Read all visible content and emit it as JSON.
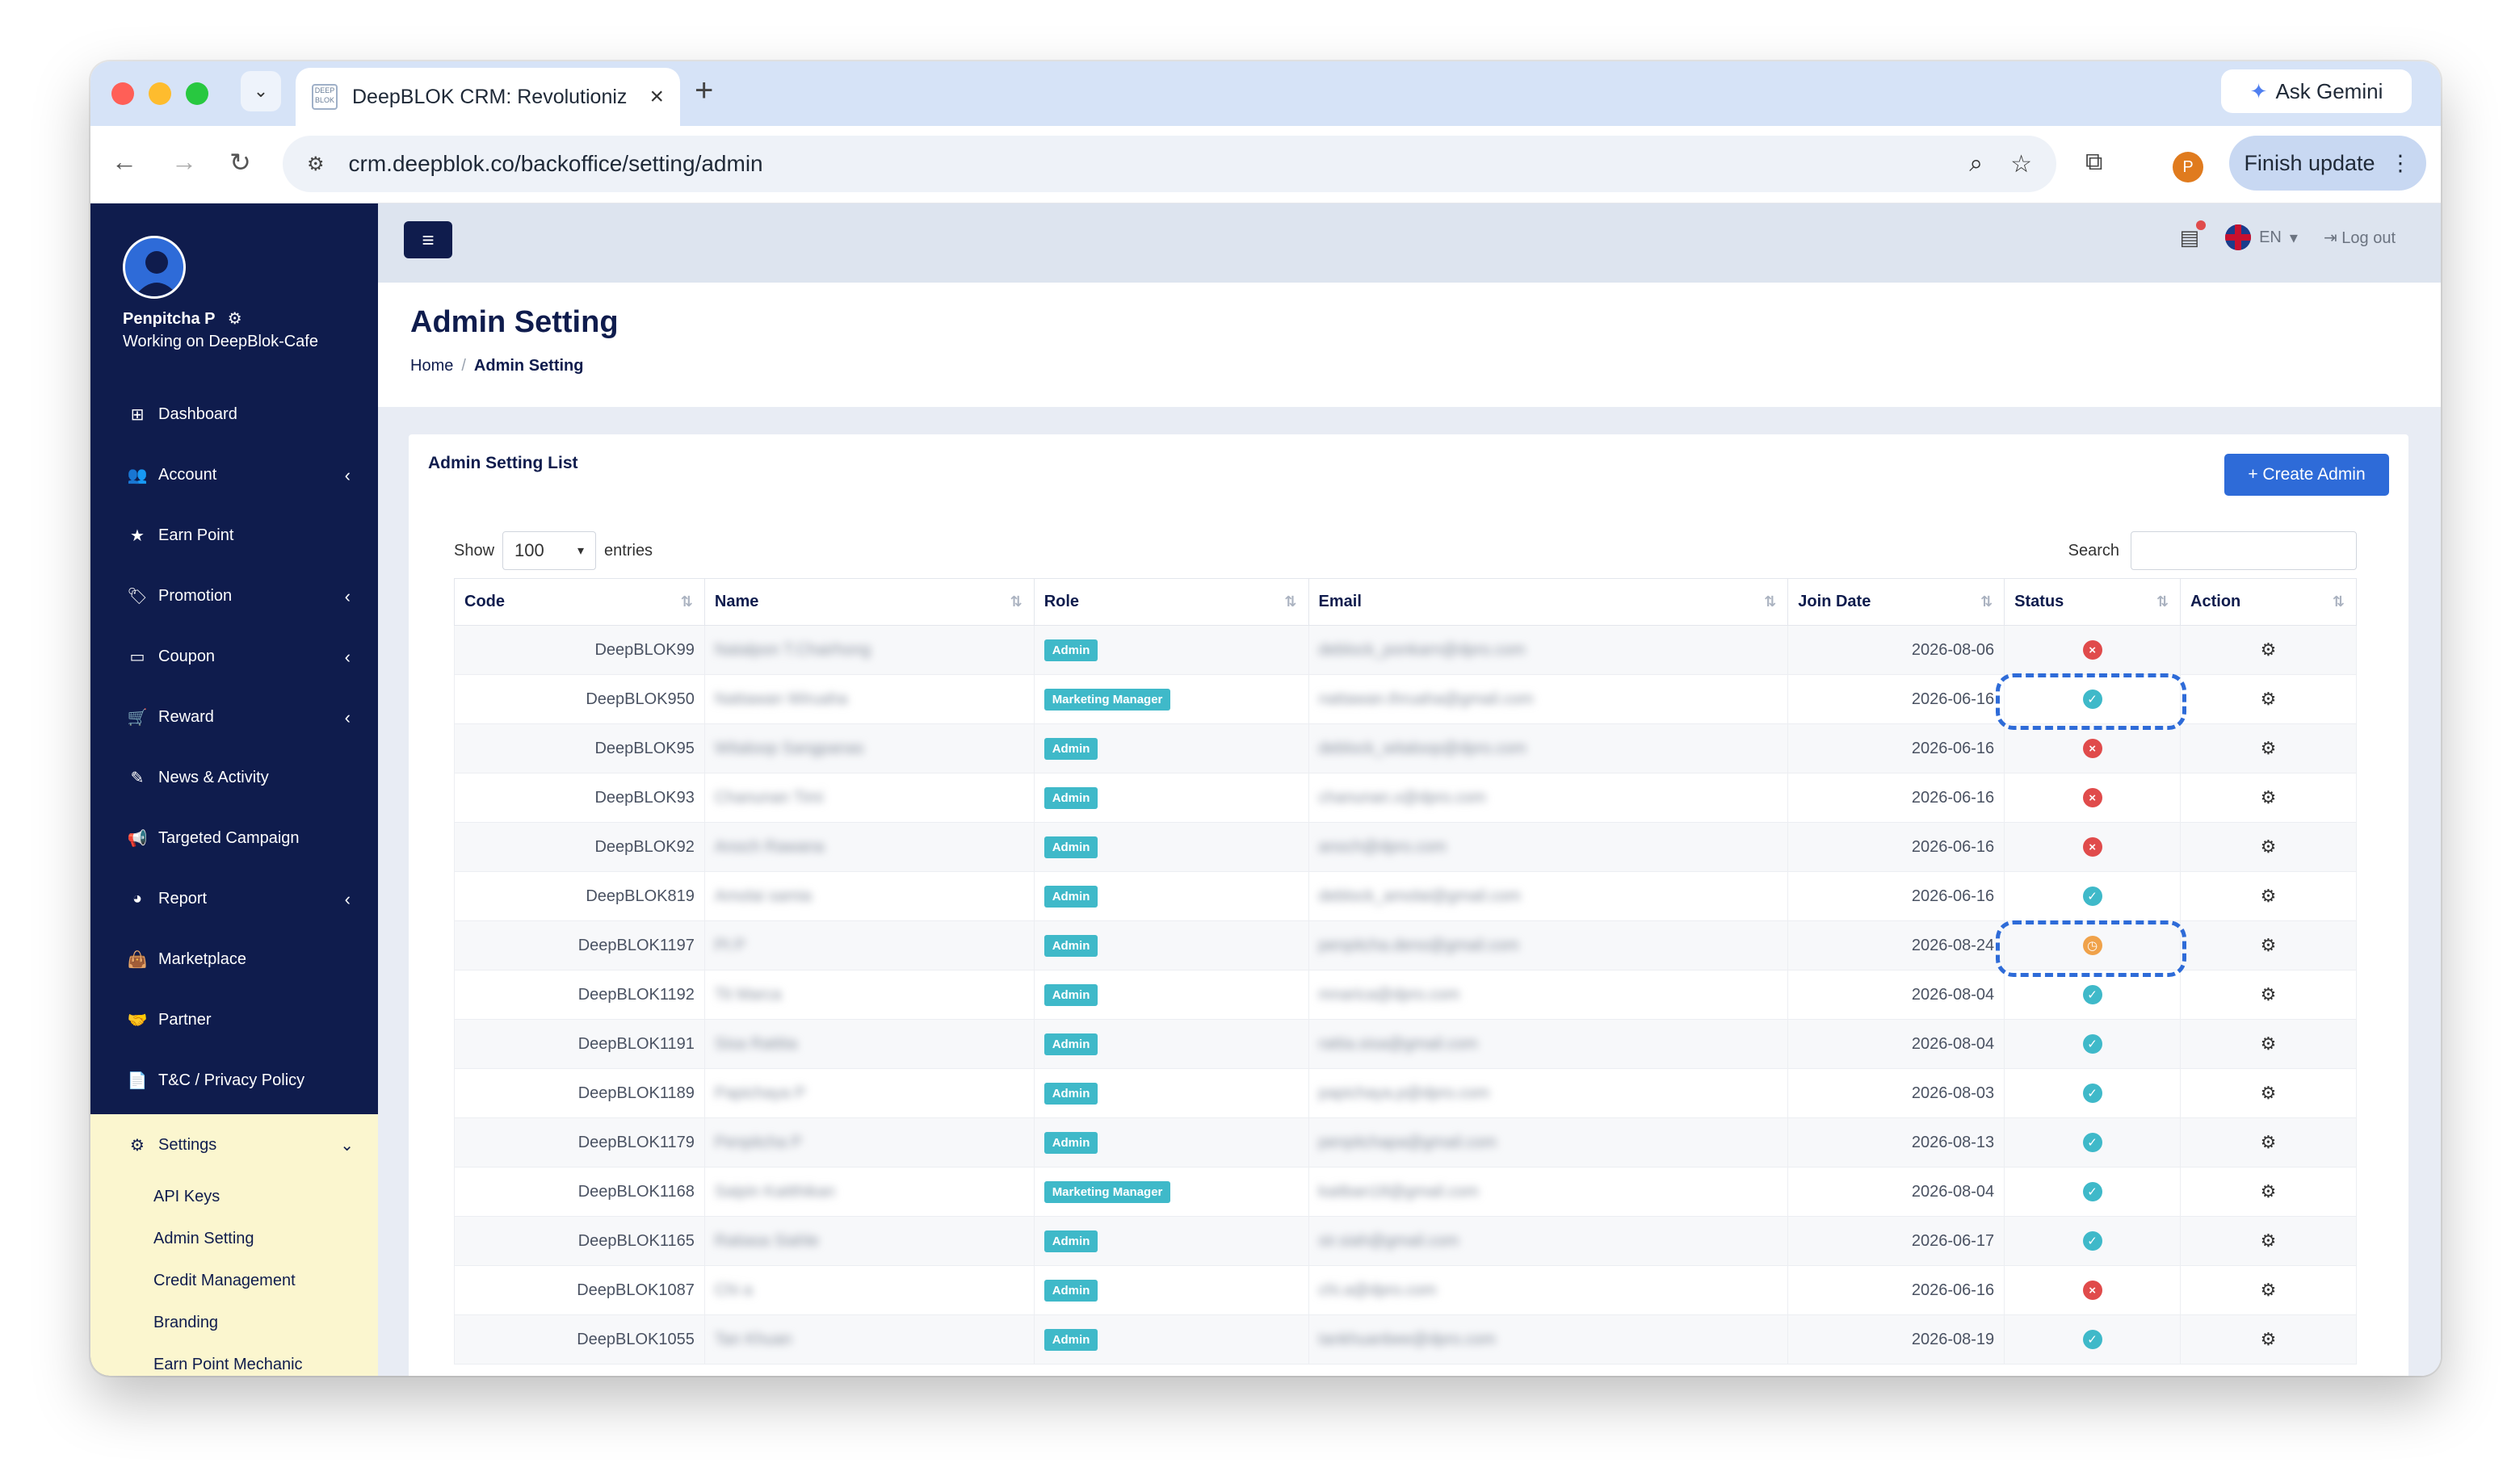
{
  "browser": {
    "tab_title": "DeepBLOK CRM: Revolutioniz",
    "favicon_text": "DEEP BLOK",
    "url": "crm.deepblok.co/backoffice/setting/admin",
    "ask_gemini": "Ask Gemini",
    "finish_update": "Finish update",
    "profile_initial": "P",
    "colors": {
      "tabbar": "#d6e3f7",
      "close": "#ff5f57",
      "minimize": "#febc2e",
      "zoom": "#28c840"
    }
  },
  "sidebar": {
    "user_name": "Penpitcha P",
    "working_on": "Working on DeepBlok-Cafe",
    "items": [
      {
        "label": "Dashboard",
        "icon": "dashboard-icon",
        "glyph": "⊞",
        "chevron": false
      },
      {
        "label": "Account",
        "icon": "users-icon",
        "glyph": "👥",
        "chevron": true
      },
      {
        "label": "Earn Point",
        "icon": "star-icon",
        "glyph": "★",
        "chevron": false
      },
      {
        "label": "Promotion",
        "icon": "tag-icon",
        "glyph": "🏷",
        "chevron": true
      },
      {
        "label": "Coupon",
        "icon": "ticket-icon",
        "glyph": "▭",
        "chevron": true
      },
      {
        "label": "Reward",
        "icon": "cart-icon",
        "glyph": "🛒",
        "chevron": true
      },
      {
        "label": "News & Activity",
        "icon": "edit-icon",
        "glyph": "✎",
        "chevron": false
      },
      {
        "label": "Targeted Campaign",
        "icon": "megaphone-icon",
        "glyph": "📢",
        "chevron": false
      },
      {
        "label": "Report",
        "icon": "chart-pie-icon",
        "glyph": "◕",
        "chevron": true
      },
      {
        "label": "Marketplace",
        "icon": "bag-icon",
        "glyph": "👜",
        "chevron": false
      },
      {
        "label": "Partner",
        "icon": "handshake-icon",
        "glyph": "🤝",
        "chevron": false
      },
      {
        "label": "T&C / Privacy Policy",
        "icon": "document-icon",
        "glyph": "📄",
        "chevron": false
      }
    ],
    "settings": {
      "label": "Settings",
      "sub_items": [
        "API Keys",
        "Admin Setting",
        "Credit Management",
        "Branding",
        "Earn Point Mechanic"
      ]
    },
    "colors": {
      "bg": "#0f1c4d",
      "settings_bg": "#fbf6cf"
    }
  },
  "topbar": {
    "language": "EN",
    "logout": "Log out"
  },
  "page": {
    "title": "Admin Setting",
    "breadcrumb_home": "Home",
    "breadcrumb_current": "Admin Setting"
  },
  "card": {
    "title": "Admin Setting List",
    "create_button": "+ Create Admin",
    "show_label": "Show",
    "entries_value": "100",
    "entries_label": "entries",
    "search_label": "Search"
  },
  "table": {
    "columns": [
      "Code",
      "Name",
      "Role",
      "Email",
      "Join Date",
      "Status",
      "Action"
    ],
    "rows": [
      {
        "code": "DeepBLOK99",
        "name": "Natalpon T.Chairhong",
        "role": "Admin",
        "email": "deblock_ponkarn@dpro.com",
        "date": "2026-08-06",
        "status": "inactive"
      },
      {
        "code": "DeepBLOK950",
        "name": "Nattawan Wiruaha",
        "role": "Marketing Manager",
        "email": "nattawan.thruaha@gmail.com",
        "date": "2026-06-16",
        "status": "active"
      },
      {
        "code": "DeepBLOK95",
        "name": "Witaloop Sangpanas",
        "role": "Admin",
        "email": "deblock_witaloop@dpro.com",
        "date": "2026-06-16",
        "status": "inactive"
      },
      {
        "code": "DeepBLOK93",
        "name": "Chanunan Timi",
        "role": "Admin",
        "email": "chanunan.x@dpro.com",
        "date": "2026-06-16",
        "status": "inactive"
      },
      {
        "code": "DeepBLOK92",
        "name": "Anoch Rawana",
        "role": "Admin",
        "email": "anoch@dpro.com",
        "date": "2026-06-16",
        "status": "inactive"
      },
      {
        "code": "DeepBLOK819",
        "name": "Amolai samia",
        "role": "Admin",
        "email": "deblock_amolai@gmail.com",
        "date": "2026-06-16",
        "status": "active"
      },
      {
        "code": "DeepBLOK1197",
        "name": "Pt P",
        "role": "Admin",
        "email": "penpitcha.deno@gmail.com",
        "date": "2026-08-24",
        "status": "pending"
      },
      {
        "code": "DeepBLOK1192",
        "name": "Tit Marca",
        "role": "Admin",
        "email": "mnarica@dpro.com",
        "date": "2026-08-04",
        "status": "active"
      },
      {
        "code": "DeepBLOK1191",
        "name": "Sisa Rattita",
        "role": "Admin",
        "email": "rattia.sisa@gmail.com",
        "date": "2026-08-04",
        "status": "active"
      },
      {
        "code": "DeepBLOK1189",
        "name": "Papichaya P",
        "role": "Admin",
        "email": "papichaya.p@dpro.com",
        "date": "2026-08-03",
        "status": "active"
      },
      {
        "code": "DeepBLOK1179",
        "name": "Penpitcha P",
        "role": "Admin",
        "email": "penpitchapa@gmail.com",
        "date": "2026-08-13",
        "status": "active"
      },
      {
        "code": "DeepBLOK1168",
        "name": "Saipin Kaitthikan",
        "role": "Marketing Manager",
        "email": "kaitban18@gmail.com",
        "date": "2026-08-04",
        "status": "active"
      },
      {
        "code": "DeepBLOK1165",
        "name": "Ratiasa Siahle",
        "role": "Admin",
        "email": "sir.siah@gmail.com",
        "date": "2026-06-17",
        "status": "active"
      },
      {
        "code": "DeepBLOK1087",
        "name": "Chi a",
        "role": "Admin",
        "email": "chi.a@dpro.com",
        "date": "2026-06-16",
        "status": "inactive"
      },
      {
        "code": "DeepBLOK1055",
        "name": "Tan Khuan",
        "role": "Admin",
        "email": "tankhuanbee@dpro.com",
        "date": "2026-08-19",
        "status": "active"
      }
    ],
    "colors": {
      "badge": "#3fb9c9",
      "inactive": "#e04b4b",
      "active": "#3fb9c9",
      "pending": "#f0a24a",
      "highlight": "#2e6bd8"
    }
  }
}
